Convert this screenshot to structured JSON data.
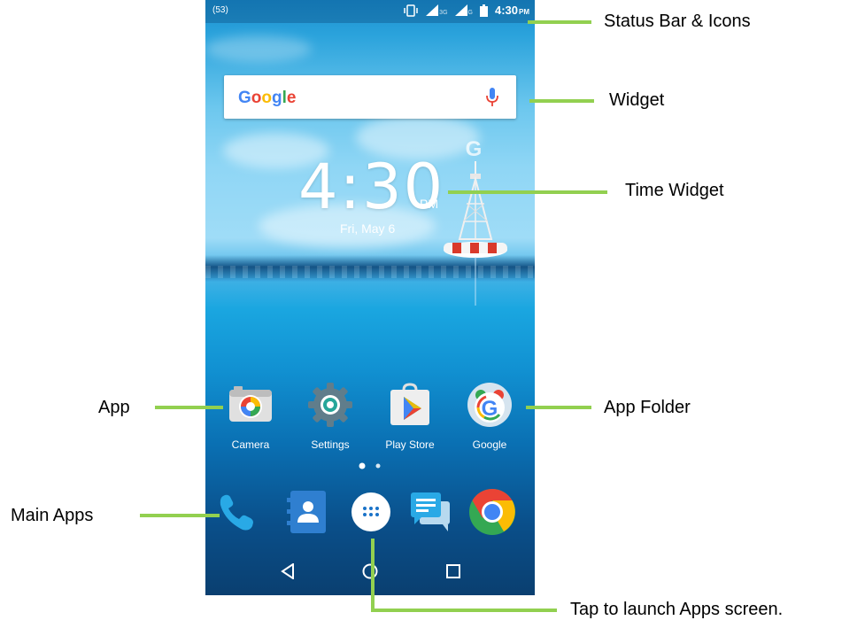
{
  "status_bar": {
    "left_badge": "(53)",
    "time": "4:30",
    "ampm": "PM",
    "network_1": "3G",
    "network_2": "G"
  },
  "search_widget": {
    "logo": "Google",
    "mic_icon": "microphone-icon"
  },
  "clock_widget": {
    "time": "4:30",
    "ampm": "PM",
    "date": "Fri, May 6"
  },
  "wallpaper_logo": "G",
  "apps": [
    {
      "label": "Camera",
      "icon": "camera-icon"
    },
    {
      "label": "Settings",
      "icon": "settings-gear-icon"
    },
    {
      "label": "Play Store",
      "icon": "play-store-icon"
    },
    {
      "label": "Google",
      "icon": "google-folder-icon"
    }
  ],
  "page_indicator": {
    "pages": 2,
    "current": 1
  },
  "dock": [
    {
      "icon": "phone-icon"
    },
    {
      "icon": "contacts-icon"
    },
    {
      "icon": "app-drawer-icon"
    },
    {
      "icon": "messages-icon"
    },
    {
      "icon": "chrome-icon"
    }
  ],
  "nav_bar": [
    "back-icon",
    "home-icon",
    "recents-icon"
  ],
  "callouts": {
    "status_bar": "Status Bar & Icons",
    "widget": "Widget",
    "time_widget": "Time Widget",
    "app": "App",
    "app_folder": "App Folder",
    "main_apps": "Main Apps",
    "launch_apps": "Tap to launch Apps screen."
  },
  "colors": {
    "callout_line": "#92d050",
    "google_blue": "#4285f4",
    "google_red": "#ea4335",
    "google_yellow": "#fbbc05",
    "google_green": "#34a853"
  }
}
